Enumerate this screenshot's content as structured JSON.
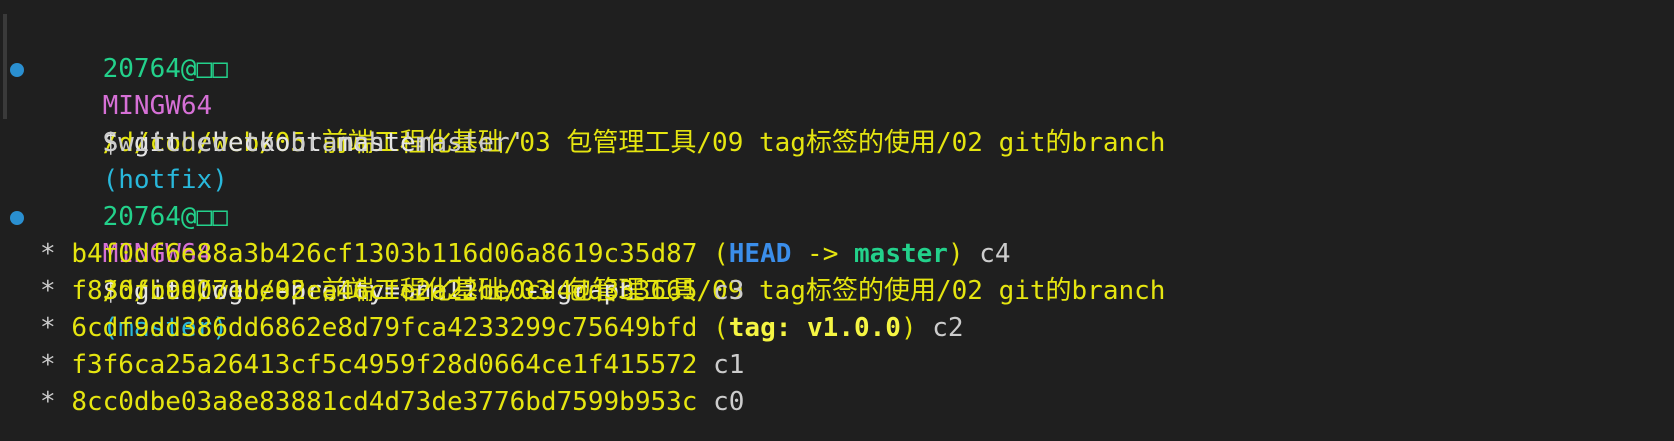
{
  "colors": {
    "background": "#1f1f1f",
    "prompt_user": "#23d18b",
    "prompt_system": "#d670d6",
    "prompt_path": "#e5e510",
    "prompt_branch": "#29b8db",
    "command_dot": "#2a8fd0"
  },
  "blocks": [
    {
      "prompt": {
        "user": "20764@□□",
        "system": "MINGW64",
        "path": "/d/cod/web/05 前端工程化基础/03 包管理工具/09 tag标签的使用/02 git的branch",
        "branch": "(hotfix)"
      },
      "command": "$ git checkout master",
      "output": [
        "Switched to branch 'master'"
      ]
    },
    {
      "prompt": {
        "user": "20764@□□",
        "system": "MINGW64",
        "path": "/d/cod/web/05 前端工程化基础/03 包管理工具/09 tag标签的使用/02 git的branch",
        "branch": "(master)"
      },
      "command": "$ git log --pretty=oneline --graph"
    }
  ],
  "log": [
    {
      "star": "*",
      "hash": "b4f0df6e88a3b426cf1303b116d06a8619c35d87",
      "ref_open": "(",
      "ref_head": "HEAD",
      "ref_arrow": " -> ",
      "ref_branch": "master",
      "ref_close": ")",
      "msg": "c4"
    },
    {
      "star": "*",
      "hash": "f830fb99071de82ea46cfe2a22be0cd4dd333665",
      "msg": "c3"
    },
    {
      "star": "*",
      "hash": "6cdf9dd386dd6862e8d79fca4233299c75649bfd",
      "ref_open": "(",
      "ref_tag": "tag: v1.0.0",
      "ref_close": ")",
      "msg": "c2"
    },
    {
      "star": "*",
      "hash": "f3f6ca25a26413cf5c4959f28d0664ce1f415572",
      "msg": "c1"
    },
    {
      "star": "*",
      "hash": "8cc0dbe03a8e83881cd4d73de3776bd7599b953c",
      "msg": "c0"
    }
  ]
}
